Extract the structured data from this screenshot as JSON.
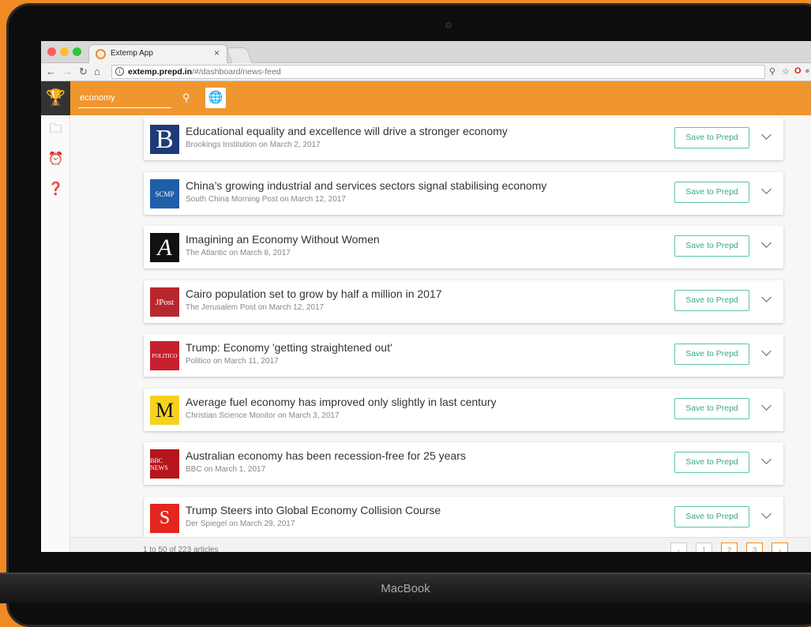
{
  "browser": {
    "tab_title": "Extemp App",
    "tab_close": "×",
    "url_host": "extemp.prepd.in",
    "url_path": "/#/dashboard/news-feed"
  },
  "app": {
    "search_value": "economy",
    "articles": [
      {
        "title": "Educational equality and excellence will drive a stronger economy",
        "source": "Brookings Institution on March 2, 2017",
        "logo_text": "B",
        "logo_bg": "#1e3a78",
        "logo_fg": "#ffffff",
        "save_label": "Save to Prepd"
      },
      {
        "title": "China’s growing industrial and services sectors signal stabilising economy",
        "source": "South China Morning Post on March 12, 2017",
        "logo_text": "SCMP",
        "logo_bg": "#1f5ea8",
        "logo_fg": "#ffffff",
        "save_label": "Save to Prepd"
      },
      {
        "title": "Imagining an Economy Without Women",
        "source": "The Atlantic on March 8, 2017",
        "logo_text": "A",
        "logo_bg": "#111111",
        "logo_fg": "#ffffff",
        "save_label": "Save to Prepd"
      },
      {
        "title": "Cairo population set to grow by half a million in 2017",
        "source": "The Jerusalem Post on March 12, 2017",
        "logo_text": "JPost",
        "logo_bg": "#b7282e",
        "logo_fg": "#ffffff",
        "save_label": "Save to Prepd"
      },
      {
        "title": "Trump: Economy 'getting straightened out'",
        "source": "Politico on March 11, 2017",
        "logo_text": "POLITICO",
        "logo_bg": "#c8202f",
        "logo_fg": "#ffffff",
        "save_label": "Save to Prepd"
      },
      {
        "title": "Average fuel economy has improved only slightly in last century",
        "source": "Christian Science Monitor on March 3, 2017",
        "logo_text": "M",
        "logo_bg": "#f6d21f",
        "logo_fg": "#111111",
        "save_label": "Save to Prepd"
      },
      {
        "title": "Australian economy has been recession-free for 25 years",
        "source": "BBC on March 1, 2017",
        "logo_text": "BBC NEWS",
        "logo_bg": "#b5161b",
        "logo_fg": "#ffffff",
        "save_label": "Save to Prepd"
      },
      {
        "title": "Trump Steers into Global Economy Collision Course",
        "source": "Der Spiegel on March 29, 2017",
        "logo_text": "S",
        "logo_bg": "#e3261f",
        "logo_fg": "#ffffff",
        "save_label": "Save to Prepd"
      }
    ],
    "footer": {
      "count_text": "1 to 50 of 223 articles",
      "pages": [
        "‹",
        "1",
        "2",
        "3",
        "›"
      ]
    }
  },
  "device": {
    "label": "MacBook"
  },
  "colors": {
    "accent": "#f0962f",
    "save_green": "#3aaa83"
  }
}
